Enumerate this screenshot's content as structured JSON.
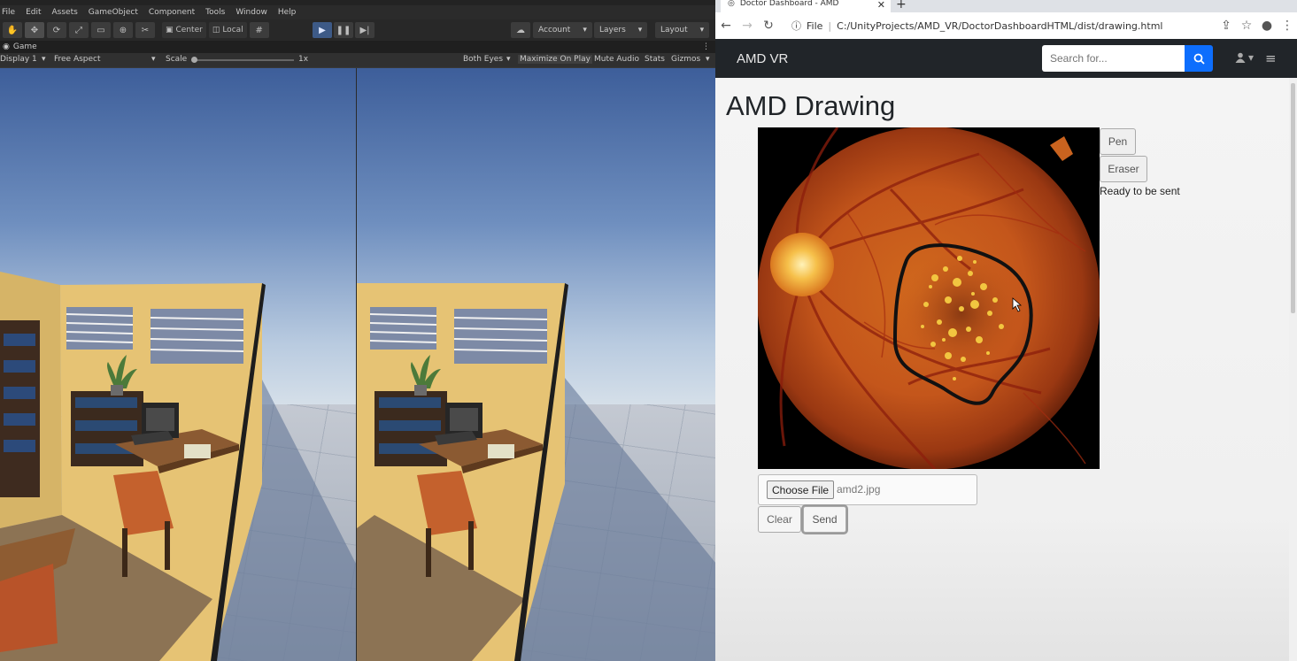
{
  "unity": {
    "menu": [
      "File",
      "Edit",
      "Assets",
      "GameObject",
      "Component",
      "Tools",
      "Window",
      "Help"
    ],
    "toolbar": {
      "pivot_label": "Center",
      "space_label": "Local",
      "account_label": "Account",
      "layers_label": "Layers",
      "layout_label": "Layout"
    },
    "game_tab": "Game",
    "game_controls": {
      "display": "Display 1",
      "aspect": "Free Aspect",
      "scale_label": "Scale",
      "scale_value": "1x",
      "eyes": "Both Eyes",
      "maximize": "Maximize On Play",
      "mute": "Mute Audio",
      "stats": "Stats",
      "gizmos": "Gizmos"
    }
  },
  "browser": {
    "tab_title": "Doctor Dashboard - AMD",
    "url_scheme": "File",
    "url_path": "C:/UnityProjects/AMD_VR/DoctorDashboardHTML/dist/drawing.html"
  },
  "app": {
    "brand": "AMD VR",
    "search_placeholder": "Search for...",
    "page_title": "AMD Drawing",
    "tools": {
      "pen": "Pen",
      "eraser": "Eraser"
    },
    "status": "Ready to be sent",
    "file": {
      "choose_label": "Choose File",
      "file_name": "amd2.jpg"
    },
    "actions": {
      "clear": "Clear",
      "send": "Send"
    }
  },
  "colors": {
    "navbar": "#212529",
    "search_button": "#0d6efd",
    "unity_play": "#3d5a87"
  }
}
